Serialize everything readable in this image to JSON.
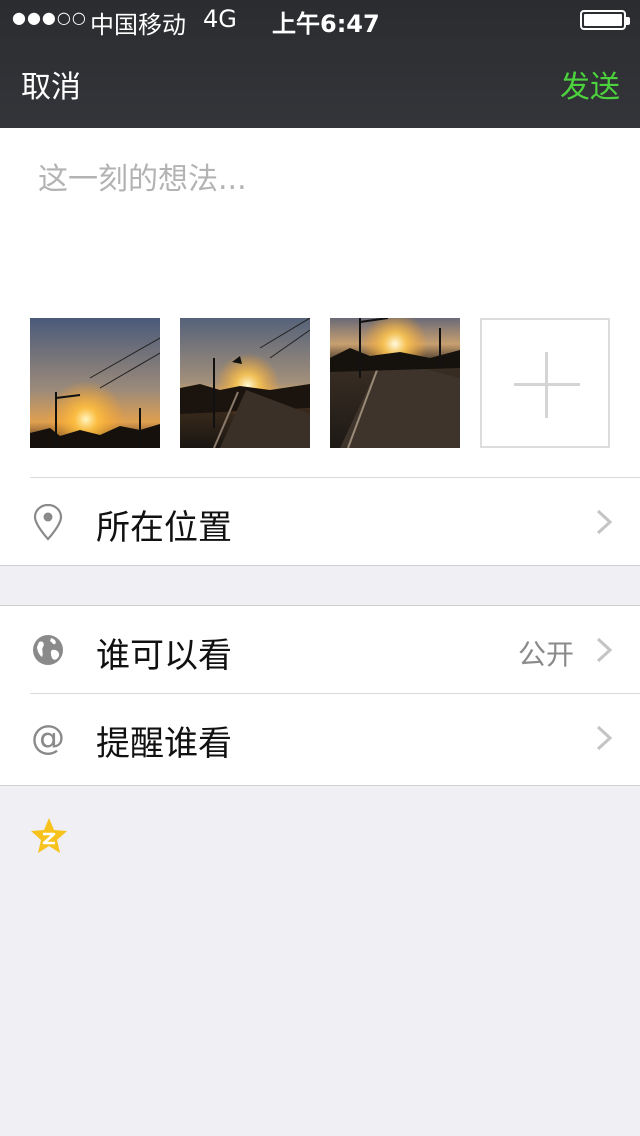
{
  "status": {
    "signal": "●●●○○",
    "carrier": "中国移动",
    "network": "4G",
    "time": "上午6:47",
    "battery_level": 1.0
  },
  "nav": {
    "cancel_label": "取消",
    "send_label": "发送",
    "send_color": "#4cd23c"
  },
  "compose": {
    "placeholder": "这一刻的想法...",
    "photo_count": 3,
    "add_photo_icon": "plus-icon"
  },
  "rows": {
    "location": {
      "label": "所在位置",
      "icon": "location-pin-icon"
    },
    "visibility": {
      "label": "谁可以看",
      "value": "公开",
      "icon": "globe-icon"
    },
    "mention": {
      "label": "提醒谁看",
      "icon": "at-icon"
    }
  },
  "footer": {
    "share_icon": "qzone-star-icon",
    "share_color": "#f7c21b"
  }
}
